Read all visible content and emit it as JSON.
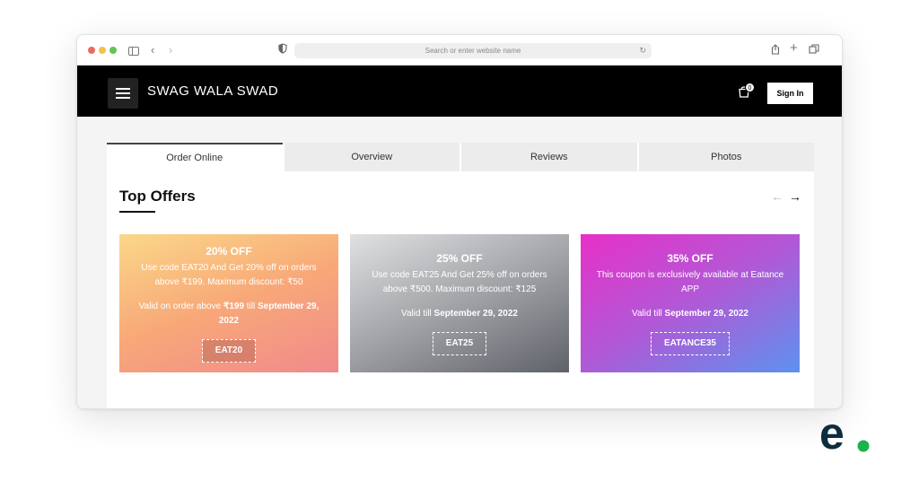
{
  "browser": {
    "url_placeholder": "Search or enter website name"
  },
  "navbar": {
    "brand": "SWAG WALA SWAD",
    "cart_count": "0",
    "signin_label": "Sign In"
  },
  "tabs": [
    {
      "label": "Order Online"
    },
    {
      "label": "Overview"
    },
    {
      "label": "Reviews"
    },
    {
      "label": "Photos"
    }
  ],
  "offers": {
    "title": "Top Offers",
    "items": [
      {
        "title": "20% OFF",
        "description": "Use code EAT20 And Get 20% off on orders above ₹199. Maximum discount: ₹50",
        "valid_prefix": "Valid on order above ",
        "valid_amount": "₹199",
        "valid_till": " till ",
        "valid_date": "September 29, 2022",
        "code": "EAT20"
      },
      {
        "title": "25% OFF",
        "description": "Use code EAT25 And Get 25% off on orders above ₹500. Maximum discount: ₹125",
        "valid_prefix": "Valid till ",
        "valid_date": "September 29, 2022",
        "code": "EAT25"
      },
      {
        "title": "35% OFF",
        "description": "This coupon is exclusively available at Eatance APP",
        "valid_prefix": "Valid till ",
        "valid_date": "September 29, 2022",
        "code": "EATANCE35"
      }
    ]
  },
  "colors": {
    "navbar_bg": "#000000",
    "logo_dark": "#0d2d3f",
    "logo_green": "#1bb24b"
  },
  "logo_letter": "e"
}
